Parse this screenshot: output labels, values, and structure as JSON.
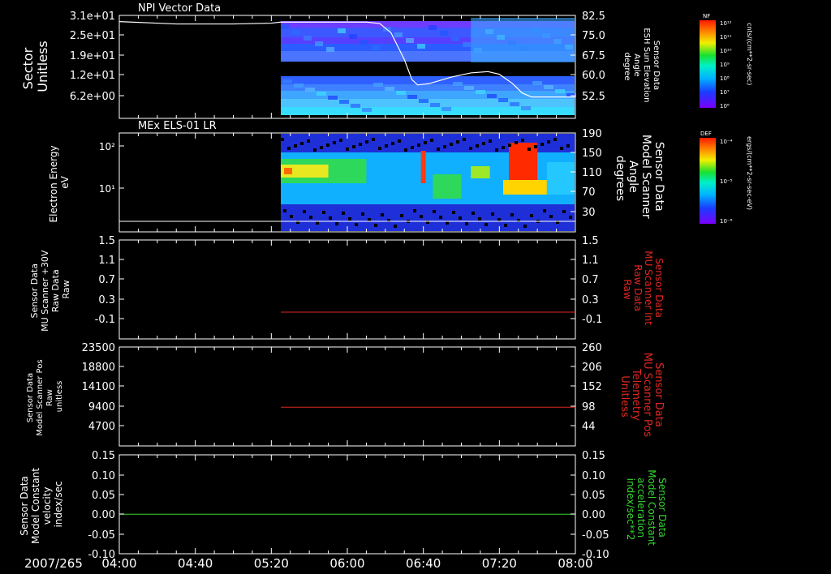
{
  "date_label": "2007/265",
  "x_ticks": [
    "04:00",
    "04:40",
    "05:20",
    "06:00",
    "06:40",
    "07:20",
    "08:00"
  ],
  "colors": {
    "white": "#ffffff",
    "red": "#e0271f",
    "green": "#34d62f"
  },
  "panels": [
    {
      "title": "NPI Vector Data",
      "left_label": [
        "Sector",
        "Unitless"
      ],
      "left_ticks": [
        "3.1e+01",
        "2.5e+01",
        "1.9e+01",
        "1.2e+01",
        "6.2e+00"
      ],
      "right_ticks": [
        "82.5",
        "75.0",
        "67.5",
        "60.0",
        "52.5"
      ],
      "right_label": [
        "Sensor Data",
        "ESH Sun Elevation",
        "Angle",
        "degree"
      ],
      "colorbar": {
        "title": "NF",
        "unit": "cnts/(cm**2-sr-sec)",
        "ticks": [
          "10¹²",
          "10¹¹",
          "10¹⁰",
          "10⁹",
          "10⁸",
          "10⁷",
          "10⁶"
        ]
      }
    },
    {
      "title": "MEx ELS-01 LR",
      "left_label": [
        "Electron Energy",
        "eV"
      ],
      "left_ticks": [
        "10²",
        "10¹"
      ],
      "right_ticks": [
        "190",
        "150",
        "110",
        "70",
        "30"
      ],
      "right_label": [
        "Sensor Data",
        "Model Scanner",
        "Angle",
        "degrees"
      ],
      "colorbar": {
        "title": "DEF",
        "unit": "ergs/(cm**2-sr-sec-eV)",
        "ticks": [
          "10⁻⁴",
          "10⁻⁵",
          "10⁻⁶"
        ]
      }
    },
    {
      "left_label": [
        "Sensor Data",
        "MU Scanner +30V",
        "Raw Data",
        "Raw"
      ],
      "left_ticks": [
        "1.5",
        "1.1",
        "0.7",
        "0.3",
        "-0.1"
      ],
      "right_ticks": [
        "1.5",
        "1.1",
        "0.7",
        "0.3",
        "-0.1"
      ],
      "right_label": [
        "Sensor Data",
        "MU Scanner Int",
        "Raw Data",
        "Raw"
      ]
    },
    {
      "left_label": [
        "Sensor Data",
        "Model Scanner Pos",
        "Raw",
        "unitless"
      ],
      "left_ticks": [
        "23500",
        "18800",
        "14100",
        "9400",
        "4700"
      ],
      "right_ticks": [
        "260",
        "206",
        "152",
        "98",
        "44"
      ],
      "right_label": [
        "Sensor Data",
        "MU Scanner Pos",
        "Telemetry",
        "Unitless"
      ]
    },
    {
      "left_label": [
        "Sensor Data",
        "Model Constant",
        "velocity",
        "index/sec"
      ],
      "left_ticks": [
        "0.15",
        "0.10",
        "0.05",
        "0.00",
        "-0.05",
        "-0.10"
      ],
      "right_ticks": [
        "0.15",
        "0.10",
        "0.05",
        "0.00",
        "-0.05",
        "-0.10"
      ],
      "right_label": [
        "Sensor Data",
        "Model Constant",
        "acceleration",
        "index/sec**2"
      ]
    }
  ],
  "chart_data": [
    {
      "type": "heatmap",
      "title": "NPI Vector Data",
      "ylabel": "Sector Unitless",
      "ylabel_right": "Sensor Data ESH Sun Elevation Angle degree",
      "x_range": [
        "04:00",
        "08:00"
      ],
      "data_start": "05:25",
      "overlay_line": {
        "name": "ESH Sun Elevation Angle",
        "axis": "right",
        "points": [
          [
            "04:00",
            80.2
          ],
          [
            "04:20",
            79.6
          ],
          [
            "04:30",
            79.3
          ],
          [
            "05:00",
            79.3
          ],
          [
            "05:20",
            79.6
          ],
          [
            "05:25",
            80.0
          ],
          [
            "05:40",
            80.0
          ],
          [
            "06:10",
            80.0
          ],
          [
            "06:17",
            79.5
          ],
          [
            "06:23",
            76.0
          ],
          [
            "06:30",
            66.0
          ],
          [
            "06:34",
            58.5
          ],
          [
            "06:37",
            56.5
          ],
          [
            "06:43",
            57.0
          ],
          [
            "06:55",
            59.5
          ],
          [
            "07:05",
            61.0
          ],
          [
            "07:14",
            61.5
          ],
          [
            "07:20",
            60.5
          ],
          [
            "07:27",
            57.0
          ],
          [
            "07:32",
            53.5
          ],
          [
            "07:37",
            52.0
          ],
          [
            "08:00",
            52.0
          ]
        ]
      }
    },
    {
      "type": "heatmap",
      "title": "MEx ELS-01 LR",
      "ylabel": "Electron Energy eV",
      "ylabel_right": "Sensor Data Model Scanner Angle degrees",
      "x_range": [
        "04:00",
        "08:00"
      ],
      "data_start": "05:25",
      "overlay_line": {
        "axis": "right",
        "points": [
          [
            "04:00",
            24
          ],
          [
            "08:00",
            24
          ]
        ]
      }
    },
    {
      "type": "line",
      "series": [
        {
          "color": "red",
          "points": [
            [
              "05:25",
              -0.1
            ],
            [
              "08:00",
              -0.1
            ]
          ]
        }
      ],
      "ylim": [
        -0.3,
        1.5
      ]
    },
    {
      "type": "line",
      "series": [
        {
          "color": "red",
          "points": [
            [
              "05:25",
              9100
            ],
            [
              "08:00",
              9100
            ]
          ]
        }
      ],
      "ylim": [
        0,
        23500
      ]
    },
    {
      "type": "line",
      "series": [
        {
          "color": "green",
          "points": [
            [
              "04:00",
              0.0
            ],
            [
              "08:00",
              0.0
            ]
          ]
        }
      ],
      "ylim": [
        -0.1,
        0.15
      ]
    }
  ]
}
